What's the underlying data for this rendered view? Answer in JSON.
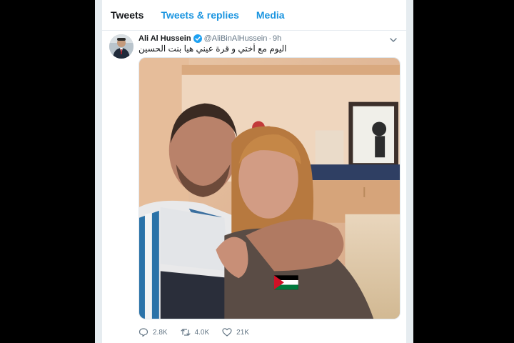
{
  "tabs": [
    {
      "label": "Tweets",
      "active": true
    },
    {
      "label": "Tweets & replies",
      "active": false
    },
    {
      "label": "Media",
      "active": false
    }
  ],
  "tweet": {
    "display_name": "Ali Al Hussein",
    "handle": "@AliBinAlHussein",
    "separator": "·",
    "time": "9h",
    "verified": true,
    "text": "اليوم مع أختي و قرة عيني هيا بنت الحسين",
    "media": {
      "flag_icon": "jordan-flag-icon"
    },
    "actions": {
      "replies": "2.8K",
      "retweets": "4.0K",
      "likes": "21K"
    }
  },
  "colors": {
    "accent": "#1b95e0",
    "verified": "#1da1f2",
    "text": "#14171a",
    "muted": "#657786",
    "background": "#000000"
  }
}
